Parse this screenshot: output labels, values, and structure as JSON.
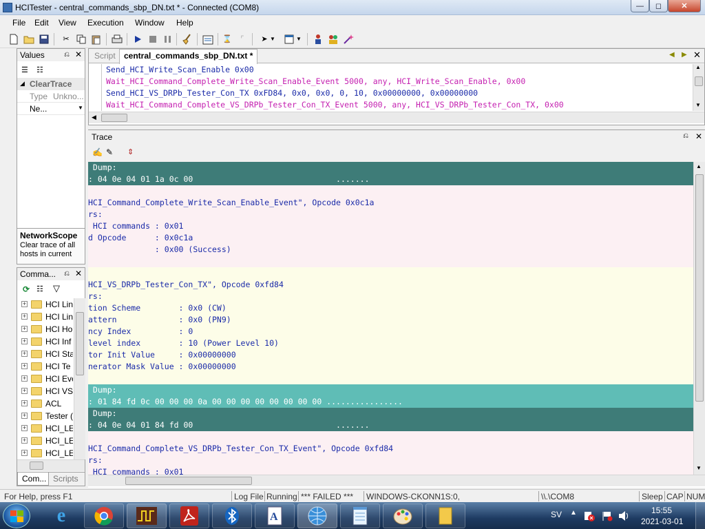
{
  "window": {
    "title": "HCITester - central_commands_sbp_DN.txt * - Connected (COM8)"
  },
  "menu": [
    "File",
    "Edit",
    "View",
    "Execution",
    "Window",
    "Help"
  ],
  "values_panel": {
    "title": "Values",
    "heading": "ClearTrace",
    "props": [
      {
        "key": "Type",
        "value": "Unkno..."
      },
      {
        "key": "Ne...",
        "value": ""
      }
    ],
    "info_title": "NetworkScope",
    "info_text": "Clear trace of all hosts in current"
  },
  "commands_panel": {
    "title": "Comma...",
    "items": [
      "HCI Lin",
      "HCI Lin",
      "HCI Ho",
      "HCI Inf",
      "HCI Sta",
      "HCI Te",
      "HCI Eve",
      "HCI VS",
      "ACL",
      "Tester (",
      "HCI_LE",
      "HCI_LE",
      "HCI_LE"
    ],
    "tabs": [
      "Com...",
      "Scripts"
    ]
  },
  "script_pane": {
    "tabs": [
      "Script",
      "central_commands_sbp_DN.txt *"
    ],
    "lines": [
      {
        "text": "Send_HCI_Write_Scan_Enable 0x00",
        "color": "#1a2aa8"
      },
      {
        "text": "Wait_HCI_Command_Complete_Write_Scan_Enable_Event 5000, any, HCI_Write_Scan_Enable, 0x00",
        "color": "#c41fb0"
      },
      {
        "text": "Send_HCI_VS_DRPb_Tester_Con_TX 0xFD84, 0x0, 0x0, 0, 10, 0x00000000, 0x00000000",
        "color": "#1a2aa8"
      },
      {
        "text": "Wait_HCI_Command_Complete_VS_DRPb_Tester_Con_TX_Event 5000, any, HCI_VS_DRPb_Tester_Con_TX, 0x00",
        "color": "#c41fb0"
      }
    ]
  },
  "trace_pane": {
    "title": "Trace",
    "blocks": [
      {
        "bg": "#3e7c78",
        "fg": "#ffffff",
        "lines": [
          " Dump:",
          ": 04 0e 04 01 1a 0c 00                              ......."
        ]
      },
      {
        "bg": "#fcf0f3",
        "fg": "#1a2aa8",
        "lines": [
          "",
          "HCI_Command_Complete_Write_Scan_Enable_Event\", Opcode 0x0c1a",
          "rs:",
          " HCI commands : 0x01",
          "d Opcode      : 0x0c1a",
          "              : 0x00 (Success)",
          ""
        ]
      },
      {
        "bg": "#fdfde8",
        "fg": "#1a2aa8",
        "lines": [
          "",
          "HCI_VS_DRPb_Tester_Con_TX\", Opcode 0xfd84",
          "rs:",
          "tion Scheme        : 0x0 (CW)",
          "attern             : 0x0 (PN9)",
          "ncy Index          : 0",
          "level index        : 10 (Power Level 10)",
          "tor Init Value     : 0x00000000",
          "nerator Mask Value : 0x00000000",
          ""
        ]
      },
      {
        "bg": "#5fbdb6",
        "fg": "#ffffff",
        "lines": [
          " Dump:",
          ": 01 84 fd 0c 00 00 00 0a 00 00 00 00 00 00 00 00 ................"
        ]
      },
      {
        "bg": "#3e7c78",
        "fg": "#ffffff",
        "lines": [
          " Dump:",
          ": 04 0e 04 01 84 fd 00                              ......."
        ]
      },
      {
        "bg": "#fcf0f3",
        "fg": "#1a2aa8",
        "lines": [
          "",
          "HCI_Command_Complete_VS_DRPb_Tester_Con_TX_Event\", Opcode 0xfd84",
          "rs:",
          " HCI commands : 0x01"
        ]
      }
    ]
  },
  "statusbar": {
    "help": "For Help, press F1",
    "logfile": "Log File",
    "running": "Running",
    "failed": "*** FAILED ***",
    "host": "WINDOWS-CKONN1S:0,",
    "port": "\\\\.\\COM8",
    "sleep": "Sleep",
    "caps": "CAP",
    "num": "NUM"
  },
  "taskbar": {
    "lang": "SV",
    "time": "15:55",
    "date": "2021-03-01"
  }
}
